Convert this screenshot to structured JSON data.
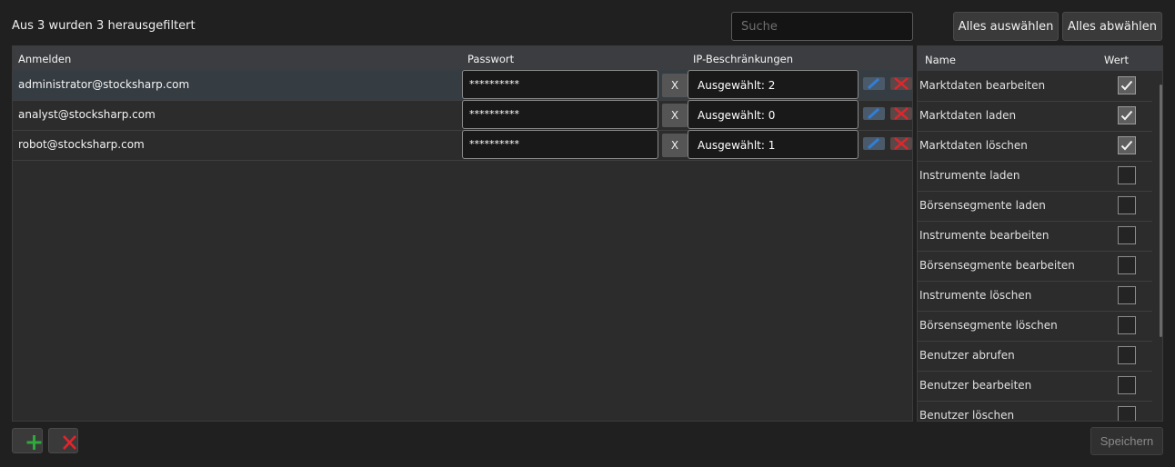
{
  "filter_status": "Aus 3 wurden 3 herausgefiltert",
  "search": {
    "placeholder": "Suche",
    "value": ""
  },
  "select_all_label": "Alles auswählen",
  "deselect_all_label": "Alles abwählen",
  "users_table": {
    "columns": [
      "Anmelden",
      "Passwort",
      "IP-Beschränkungen"
    ],
    "rows": [
      {
        "login": "administrator@stocksharp.com",
        "password": "**********",
        "clear_label": "X",
        "ip": "Ausgewählt: 2",
        "selected": true
      },
      {
        "login": "analyst@stocksharp.com",
        "password": "**********",
        "clear_label": "X",
        "ip": "Ausgewählt: 0",
        "selected": false
      },
      {
        "login": "robot@stocksharp.com",
        "password": "**********",
        "clear_label": "X",
        "ip": "Ausgewählt: 1",
        "selected": false
      }
    ]
  },
  "permissions_table": {
    "columns": [
      "Name",
      "Wert"
    ],
    "rows": [
      {
        "name": "Marktdaten bearbeiten",
        "checked": true
      },
      {
        "name": "Marktdaten laden",
        "checked": true
      },
      {
        "name": "Marktdaten löschen",
        "checked": true
      },
      {
        "name": "Instrumente laden",
        "checked": false
      },
      {
        "name": "Börsensegmente laden",
        "checked": false
      },
      {
        "name": "Instrumente bearbeiten",
        "checked": false
      },
      {
        "name": "Börsensegmente bearbeiten",
        "checked": false
      },
      {
        "name": "Instrumente löschen",
        "checked": false
      },
      {
        "name": "Börsensegmente löschen",
        "checked": false
      },
      {
        "name": "Benutzer abrufen",
        "checked": false
      },
      {
        "name": "Benutzer bearbeiten",
        "checked": false
      },
      {
        "name": "Benutzer löschen",
        "checked": false
      }
    ]
  },
  "save_label": "Speichern",
  "icons": {
    "add": "plus-icon",
    "remove": "x-icon",
    "edit": "pencil-icon",
    "delete": "x-icon",
    "check": "check-icon"
  },
  "colors": {
    "add_icon": "#2eaa3a",
    "delete_icon": "#e0262d",
    "edit_icon": "#2f7fd8"
  }
}
